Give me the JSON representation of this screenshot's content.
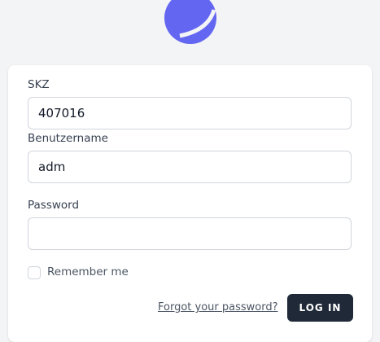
{
  "logo": {
    "name": "app-logo",
    "color": "#6366f1"
  },
  "form": {
    "skz_label": "SKZ",
    "skz_value": "407016",
    "username_label": "Benutzername",
    "username_value": "adm",
    "password_label": "Password",
    "password_value": "",
    "remember_label": "Remember me",
    "remember_checked": false,
    "forgot_label": "Forgot your password?",
    "login_label": "LOG IN"
  },
  "colors": {
    "accent": "#6366f1",
    "button_bg": "#1f2937",
    "page_bg": "#f3f4f6"
  }
}
